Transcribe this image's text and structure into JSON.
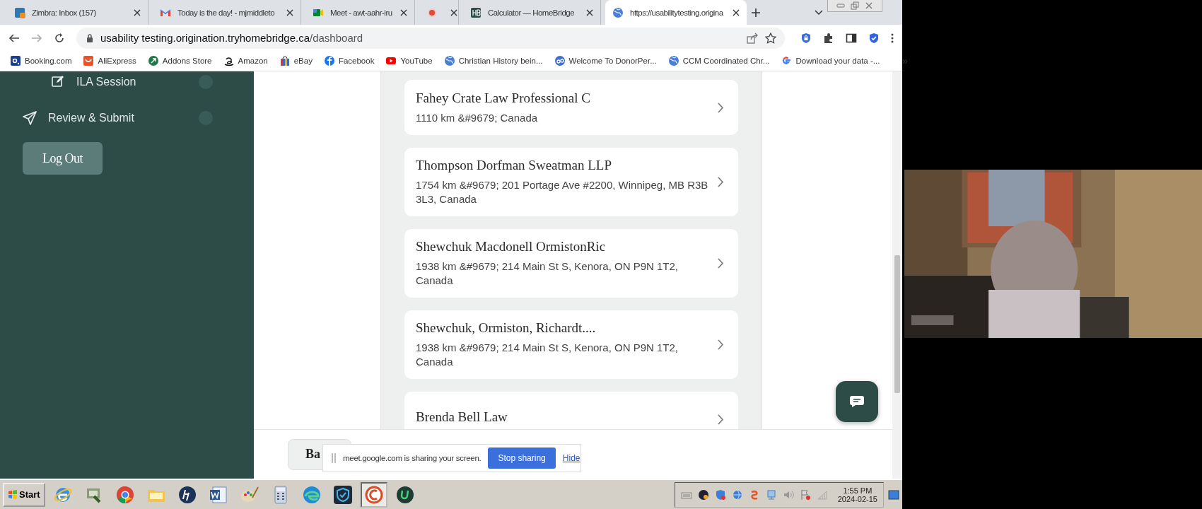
{
  "browser": {
    "tabs": [
      {
        "kind": "zimbra",
        "title": "Zimbra: Inbox (157)",
        "selected": false
      },
      {
        "kind": "gmail",
        "title": "Today is the day! - mjmiddleto",
        "selected": false
      },
      {
        "kind": "meet",
        "title": "Meet - awt-aahr-iru",
        "selected": false
      },
      {
        "kind": "recording",
        "selected": false
      },
      {
        "kind": "hb",
        "title": "Calculator — HomeBridge",
        "selected": false
      },
      {
        "kind": "globe",
        "title": "https://usabilitytesting.origina",
        "selected": true
      }
    ],
    "url": "**usability testing.origination.tryhomebridge.ca**/dashboard",
    "bookmarks": [
      {
        "kind": "booking",
        "label": "Booking.com"
      },
      {
        "kind": "aliexpress",
        "label": "AliExpress"
      },
      {
        "kind": "addons",
        "label": "Addons Store"
      },
      {
        "kind": "amazon",
        "label": "Amazon"
      },
      {
        "kind": "ebay",
        "label": "eBay"
      },
      {
        "kind": "facebook",
        "label": "Facebook"
      },
      {
        "kind": "youtube",
        "label": "YouTube"
      },
      {
        "kind": "globe",
        "label": "Christian History bein..."
      },
      {
        "kind": "dp",
        "label": "Welcome To DonorPer..."
      },
      {
        "kind": "globe",
        "label": "CCM Coordinated Chr..."
      },
      {
        "kind": "google",
        "label": "Download your data -..."
      }
    ],
    "overflow": "»"
  },
  "sidebar": {
    "items": [
      {
        "kind": "edit",
        "label": "ILA Session"
      },
      {
        "kind": "send",
        "label": "Review & Submit"
      }
    ],
    "logout": "Log Out"
  },
  "results": [
    {
      "name": "Fahey Crate Law Professional C",
      "detail": "1110 km &#9679; Canada"
    },
    {
      "name": "Thompson Dorfman Sweatman LLP",
      "detail": "1754 km &#9679; 201 Portage Ave #2200, Winnipeg, MB R3B 3L3, Canada"
    },
    {
      "name": "Shewchuk Macdonell OrmistonRic",
      "detail": "1938 km &#9679; 214 Main St S, Kenora, ON P9N 1T2, Canada"
    },
    {
      "name": "Shewchuk, Ormiston, Richardt....",
      "detail": "1938 km &#9679; 214 Main St S, Kenora, ON P9N 1T2, Canada"
    },
    {
      "name": "Brenda Bell Law"
    }
  ],
  "footer": {
    "back": "Ba"
  },
  "share_bar": {
    "message": "meet.google.com is sharing your screen.",
    "stop": "Stop sharing",
    "hide": "Hide"
  },
  "taskbar": {
    "start": "Start",
    "apps": [
      {
        "kind": "ie"
      },
      {
        "kind": "tool"
      },
      {
        "kind": "chrome"
      },
      {
        "kind": "folder"
      },
      {
        "kind": "hp"
      },
      {
        "kind": "word"
      },
      {
        "kind": "paint"
      },
      {
        "kind": "calc"
      },
      {
        "kind": "edge"
      },
      {
        "kind": "shield"
      },
      {
        "kind": "ccleaner",
        "selected": true
      },
      {
        "kind": "u"
      }
    ],
    "tray": [
      {
        "kind": "keyboard"
      },
      {
        "kind": "dark"
      },
      {
        "kind": "shield"
      },
      {
        "kind": "globe"
      },
      {
        "kind": "swirl"
      },
      {
        "kind": "net"
      },
      {
        "kind": "sound"
      },
      {
        "kind": "flag"
      },
      {
        "kind": "signal"
      }
    ],
    "time": "1:55 PM",
    "date": "2024-02-15"
  }
}
